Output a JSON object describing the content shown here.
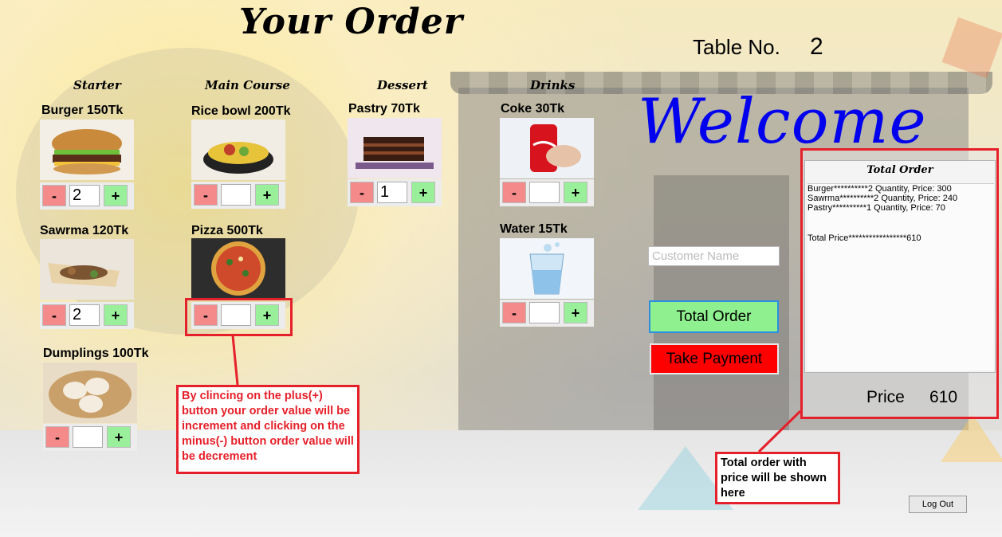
{
  "header": {
    "title": "Your Order",
    "table_label": "Table No.",
    "table_number": "2",
    "welcome": "Welcome"
  },
  "categories": {
    "starter": "Starter",
    "main_course": "Main Course",
    "dessert": "Dessert",
    "drinks": "Drinks"
  },
  "items": {
    "burger": {
      "label": "Burger 150Tk",
      "qty": "2",
      "minus": "-",
      "plus": "+"
    },
    "sawrma": {
      "label": "Sawrma 120Tk",
      "qty": "2",
      "minus": "-",
      "plus": "+"
    },
    "dumplings": {
      "label": "Dumplings 100Tk",
      "qty": "",
      "minus": "-",
      "plus": "+"
    },
    "rice_bowl": {
      "label": "Rice bowl 200Tk",
      "qty": "",
      "minus": "-",
      "plus": "+"
    },
    "pizza": {
      "label": "Pizza 500Tk",
      "qty": "",
      "minus": "-",
      "plus": "+"
    },
    "pastry": {
      "label": "Pastry 70Tk",
      "qty": "1",
      "minus": "-",
      "plus": "+"
    },
    "coke": {
      "label": "Coke 30Tk",
      "qty": "",
      "minus": "-",
      "plus": "+"
    },
    "water": {
      "label": "Water 15Tk",
      "qty": "",
      "minus": "-",
      "plus": "+"
    }
  },
  "customer": {
    "placeholder": "Customer Name",
    "value": ""
  },
  "buttons": {
    "total_order": "Total Order",
    "take_payment": "Take Payment",
    "log_out": "Log Out"
  },
  "order_summary": {
    "title": "Total Order",
    "lines": [
      "Burger**********2 Quantity, Price: 300",
      "Sawrma**********2 Quantity, Price: 240",
      "Pastry**********1 Quantity, Price: 70"
    ],
    "total_line": "Total Price*****************610",
    "price_label": "Price",
    "price_value": "610"
  },
  "annotations": {
    "stepper_help": "By clincing on the plus(+) button your order value will be increment and clicking on the minus(-) button order value will be decrement",
    "summary_help": "Total order with price will be shown here"
  },
  "colors": {
    "accent_red": "#e6202a",
    "minus_red": "#f48a8a",
    "plus_green": "#9af09a",
    "welcome_blue": "#0000ee",
    "payment_red": "#ff0000"
  }
}
